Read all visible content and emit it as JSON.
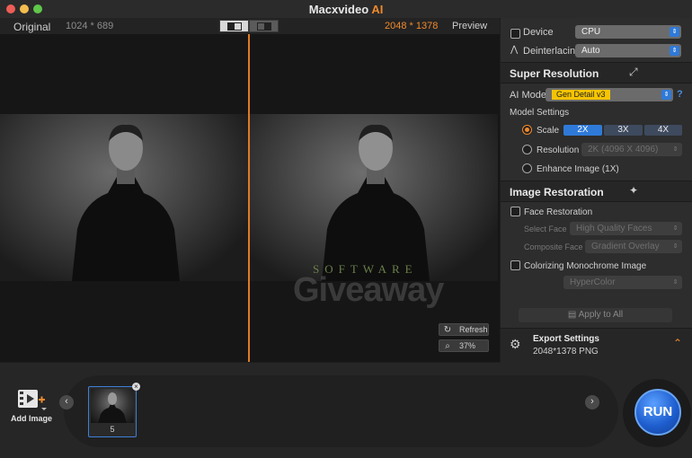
{
  "window": {
    "title_main": "Macxvideo",
    "title_accent": "AI"
  },
  "viewer": {
    "original_label": "Original",
    "original_resolution": "1024 * 689",
    "output_resolution": "2048 * 1378",
    "preview_label": "Preview",
    "refresh_label": "Refresh",
    "zoom_label": "37%",
    "watermark_top": "SOFTWARE",
    "watermark_main": "Giveaway"
  },
  "panel": {
    "device_label": "Device",
    "device_value": "CPU",
    "deinterlacing_label": "Deinterlacing",
    "deinterlacing_value": "Auto",
    "super_resolution": {
      "title": "Super Resolution",
      "ai_model_label": "AI Model",
      "ai_model_value": "Gen Detail v3",
      "help": "?",
      "model_settings_label": "Model Settings",
      "scale_label": "Scale",
      "scale_options": [
        "2X",
        "3X",
        "4X"
      ],
      "scale_selected": "2X",
      "resolution_label": "Resolution",
      "resolution_value": "2K (4096 X 4096)",
      "enhance_label": "Enhance Image (1X)"
    },
    "image_restoration": {
      "title": "Image Restoration",
      "face_restoration_label": "Face Restoration",
      "select_face_label": "Select Face",
      "select_face_value": "High Quality Faces",
      "composite_face_label": "Composite Face",
      "composite_face_value": "Gradient Overlay",
      "colorizing_label": "Colorizing Monochrome Image",
      "colorizing_value": "HyperColor"
    },
    "apply_all_label": "Apply to All",
    "export": {
      "title": "Export Settings",
      "detail": "2048*1378 PNG"
    }
  },
  "bottom": {
    "add_image_label": "Add Image",
    "thumb_number": "5",
    "run_label": "RUN"
  },
  "colors": {
    "accent": "#f08a2c",
    "blue": "#2f7ad9",
    "model_badge": "#f5c400"
  }
}
